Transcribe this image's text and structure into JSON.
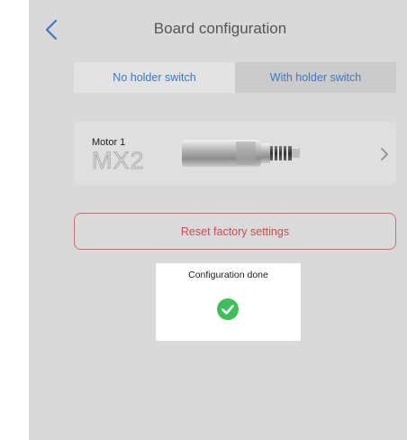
{
  "header": {
    "title": "Board configuration",
    "back_icon": "chevron-left-icon"
  },
  "segments": {
    "left_label": "No holder switch",
    "right_label": "With holder switch",
    "selected": "No holder switch"
  },
  "motor": {
    "label": "Motor 1",
    "model": "MX2",
    "chevron_icon": "chevron-right-icon"
  },
  "reset": {
    "label": "Reset factory settings"
  },
  "dialog": {
    "message": "Configuration done",
    "icon": "check-circle-icon"
  },
  "colors": {
    "accent": "#3d79c4",
    "danger": "#cc4c4c",
    "success": "#3fbf5a",
    "overlay_bg": "#d9d9d9"
  }
}
